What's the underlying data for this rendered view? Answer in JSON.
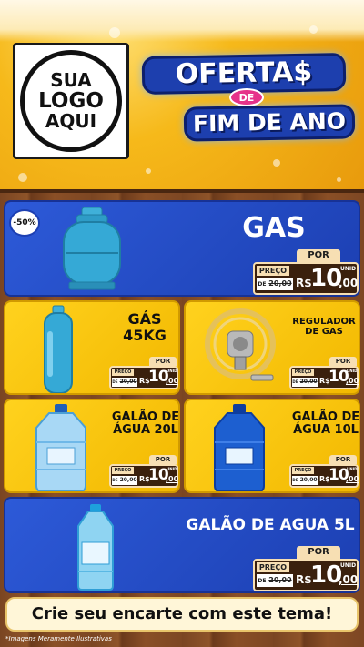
{
  "header": {
    "logo": {
      "line1": "SUA",
      "line2": "LOGO",
      "line3": "AQUI"
    },
    "title": {
      "line1": "OFERTA$",
      "connector": "DE",
      "line2": "FIM DE ANO"
    }
  },
  "products": [
    {
      "name": "GAS",
      "badge": "-50%",
      "price": {
        "por": "POR",
        "preco": "PREÇO",
        "de": "DE",
        "old": "20,00",
        "currency": "R$",
        "integer": "10",
        "cents": ",00",
        "unit": "UNID"
      }
    },
    {
      "name_line1": "GÁS",
      "name_line2": "45KG",
      "price": {
        "por": "POR",
        "preco": "PREÇO",
        "de": "DE",
        "old": "20,00",
        "currency": "R$",
        "integer": "10",
        "cents": ",00",
        "unit": "UNID"
      }
    },
    {
      "name_line1": "REGULADOR",
      "name_line2": "DE GAS",
      "price": {
        "por": "POR",
        "preco": "PREÇO",
        "de": "DE",
        "old": "20,00",
        "currency": "R$",
        "integer": "10",
        "cents": ",00",
        "unit": "UNID"
      }
    },
    {
      "name_line1": "GALÃO DE",
      "name_line2": "ÁGUA 20L",
      "price": {
        "por": "POR",
        "preco": "PREÇO",
        "de": "DE",
        "old": "20,00",
        "currency": "R$",
        "integer": "10",
        "cents": ",00",
        "unit": "UNID"
      }
    },
    {
      "name_line1": "GALÃO DE",
      "name_line2": "ÁGUA 10L",
      "price": {
        "por": "POR",
        "preco": "PREÇO",
        "de": "DE",
        "old": "20,00",
        "currency": "R$",
        "integer": "10",
        "cents": ",00",
        "unit": "UNID"
      }
    },
    {
      "name": "GALÃO DE AGUA 5L",
      "price": {
        "por": "POR",
        "preco": "PREÇO",
        "de": "DE",
        "old": "20,00",
        "currency": "R$",
        "integer": "10",
        "cents": ",00",
        "unit": "UNID"
      }
    }
  ],
  "banner": {
    "text": "Crie seu encarte com este tema!"
  },
  "footnote": "*Imagens Meramente Ilustrativas",
  "colors": {
    "card_blue": "#1c3fb2",
    "card_yellow": "#f2b800",
    "price_body": "#3a200d",
    "price_label": "#f7dfb3"
  }
}
